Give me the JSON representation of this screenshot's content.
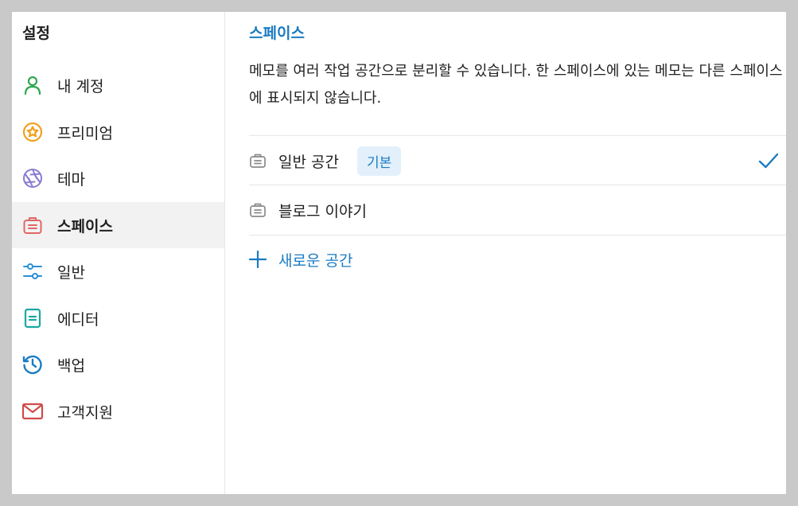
{
  "sidebar": {
    "title": "설정",
    "items": [
      {
        "label": "내 계정",
        "icon": "person-icon",
        "color": "#2fa84f"
      },
      {
        "label": "프리미엄",
        "icon": "star-badge-icon",
        "color": "#f0a020"
      },
      {
        "label": "테마",
        "icon": "aperture-icon",
        "color": "#8a7bd1"
      },
      {
        "label": "스페이스",
        "icon": "briefcase-icon",
        "color": "#e06666",
        "active": true
      },
      {
        "label": "일반",
        "icon": "sliders-icon",
        "color": "#2b8fd6"
      },
      {
        "label": "에디터",
        "icon": "document-icon",
        "color": "#1aa9a1"
      },
      {
        "label": "백업",
        "icon": "history-icon",
        "color": "#1a7bc2"
      },
      {
        "label": "고객지원",
        "icon": "mail-icon",
        "color": "#d04a4a"
      }
    ]
  },
  "main": {
    "title": "스페이스",
    "description": "메모를 여러 작업 공간으로 분리할 수 있습니다. 한 스페이스에 있는 메모는 다른 스페이스에 표시되지 않습니다.",
    "spaces": [
      {
        "name": "일반 공간",
        "badge": "기본",
        "selected": true
      },
      {
        "name": "블로그 이야기",
        "selected": false
      }
    ],
    "new_space_label": "새로운 공간"
  },
  "colors": {
    "accent": "#1a7bc2",
    "badge_bg": "#e3f0fb",
    "active_bg": "#f2f2f2"
  }
}
